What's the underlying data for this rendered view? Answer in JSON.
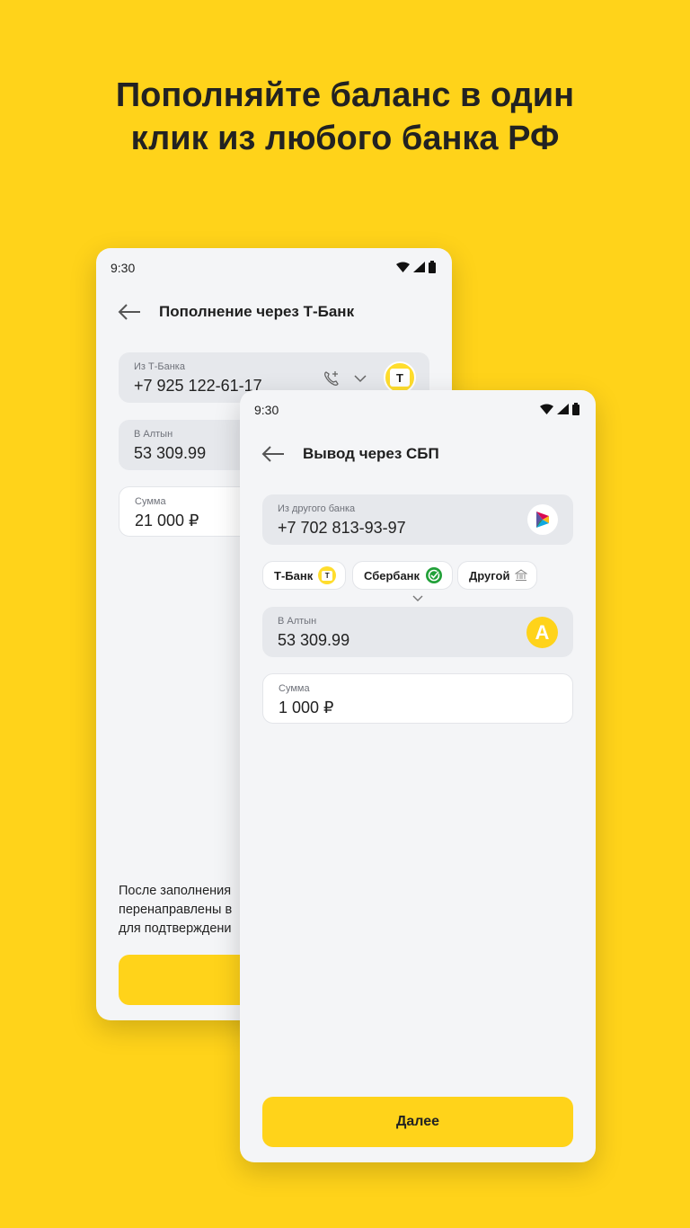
{
  "headline": "Пополняйте баланс в один клик из любого банка РФ",
  "back_screen": {
    "time": "9:30",
    "title": "Пополнение через Т-Банк",
    "from_field": {
      "label": "Из Т-Банка",
      "value": "+7 925 122-61-17",
      "bank_logo_letter": "Т"
    },
    "to_field": {
      "label": "В Алтын",
      "value": "53 309.99"
    },
    "amount_field": {
      "label": "Сумма",
      "value": "21 000 ₽"
    },
    "note_lines": [
      "После заполнения",
      "перенаправлены в",
      "для подтверждени"
    ],
    "button_label": ""
  },
  "front_screen": {
    "time": "9:30",
    "title": "Вывод через СБП",
    "from_field": {
      "label": "Из другого банка",
      "value": "+7 702 813-93-97"
    },
    "bank_chips": [
      {
        "label": "Т-Банк",
        "icon": "tbank-logo-icon"
      },
      {
        "label": "Сбербанк",
        "icon": "sber-logo-icon"
      },
      {
        "label": "Другой",
        "icon": "bank-building-icon"
      }
    ],
    "to_field": {
      "label": "В Алтын",
      "value": "53 309.99",
      "logo_letter": "A"
    },
    "amount_field": {
      "label": "Сумма",
      "value": "1 000 ₽"
    },
    "button_label": "Далее"
  },
  "colors": {
    "background": "#FFD31A",
    "accent": "#FFD31A",
    "sber_green": "#21A038"
  }
}
